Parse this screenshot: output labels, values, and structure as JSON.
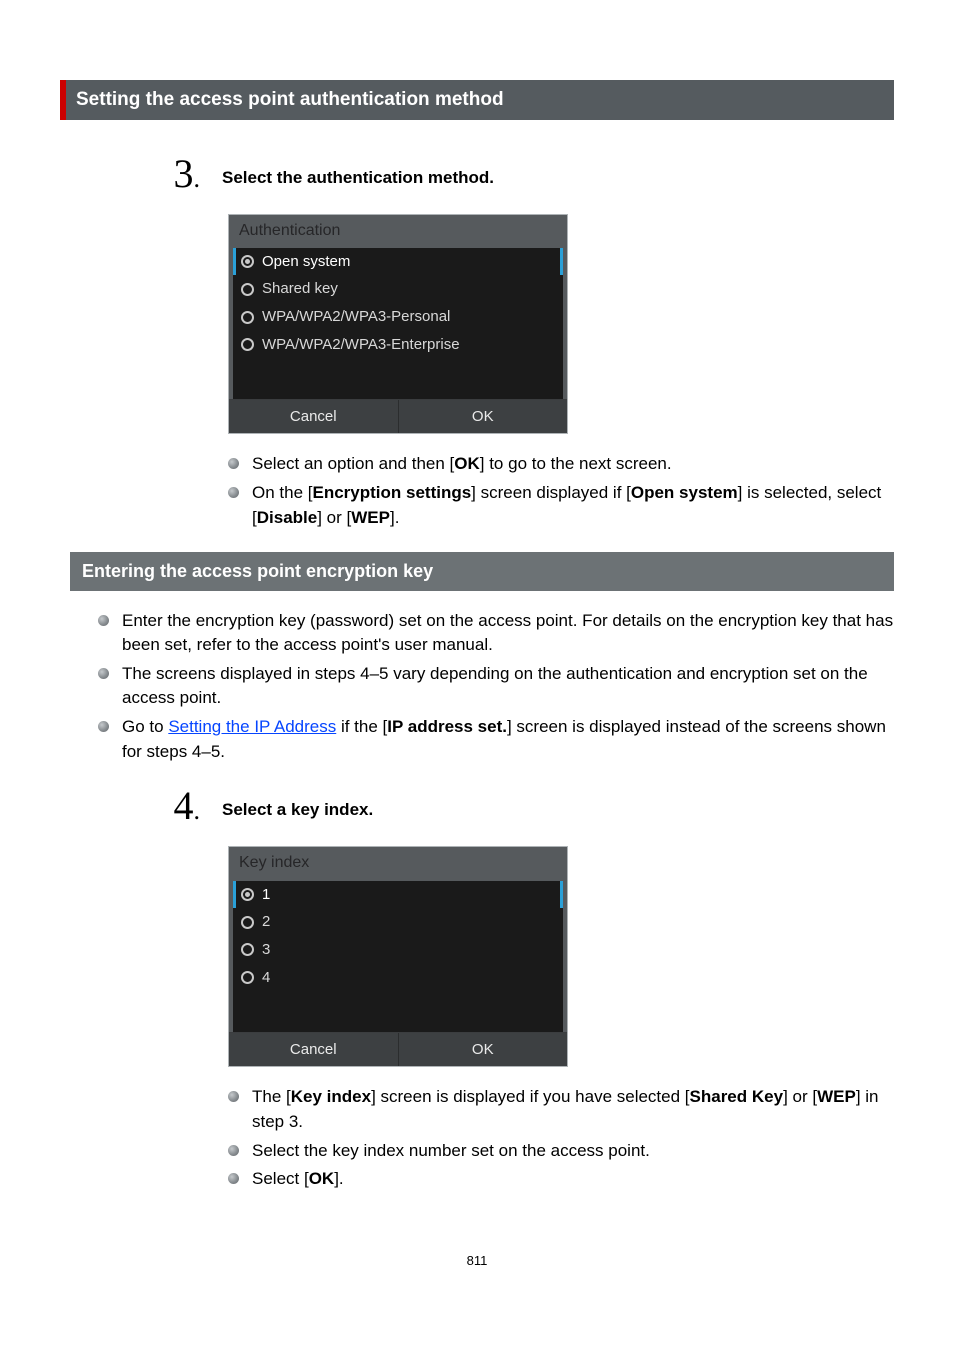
{
  "headings": {
    "auth_method": "Setting the access point authentication method",
    "encryption_key": "Entering the access point encryption key"
  },
  "step3": {
    "number": "3",
    "title": "Select the authentication method.",
    "screenshot": {
      "title": "Authentication",
      "options": {
        "open": "Open system",
        "shared": "Shared key",
        "personal": "WPA/WPA2/WPA3-Personal",
        "enterprise": "WPA/WPA2/WPA3-Enterprise"
      },
      "cancel": "Cancel",
      "ok": "OK"
    },
    "bullets": {
      "b1_pre": "Select an option and then [",
      "b1_ok": "OK",
      "b1_post": "] to go to the next screen.",
      "b2_a": "On the [",
      "b2_enc": "Encryption settings",
      "b2_b": "] screen displayed if [",
      "b2_open": "Open system",
      "b2_c": "] is selected, select [",
      "b2_disable": "Disable",
      "b2_d": "] or [",
      "b2_wep": "WEP",
      "b2_e": "]."
    }
  },
  "intro_list": {
    "l1": "Enter the encryption key (password) set on the access point. For details on the encryption key that has been set, refer to the access point's user manual.",
    "l2": "The screens displayed in steps 4–5 vary depending on the authentication and encryption set on the access point.",
    "l3_a": "Go to ",
    "l3_link": "Setting the IP Address",
    "l3_b": " if the [",
    "l3_ip": "IP address set.",
    "l3_c": "] screen is displayed instead of the screens shown for steps 4–5."
  },
  "step4": {
    "number": "4",
    "title": "Select a key index.",
    "screenshot": {
      "title": "Key index",
      "options": {
        "o1": "1",
        "o2": "2",
        "o3": "3",
        "o4": "4"
      },
      "cancel": "Cancel",
      "ok": "OK"
    },
    "bullets": {
      "b1_a": "The [",
      "b1_ki": "Key index",
      "b1_b": "] screen is displayed if you have selected [",
      "b1_sk": "Shared Key",
      "b1_c": "] or [",
      "b1_wep": "WEP",
      "b1_d": "] in step 3.",
      "b2": "Select the key index number set on the access point.",
      "b3_a": "Select [",
      "b3_ok": "OK",
      "b3_b": "]."
    }
  },
  "page_number": "811"
}
